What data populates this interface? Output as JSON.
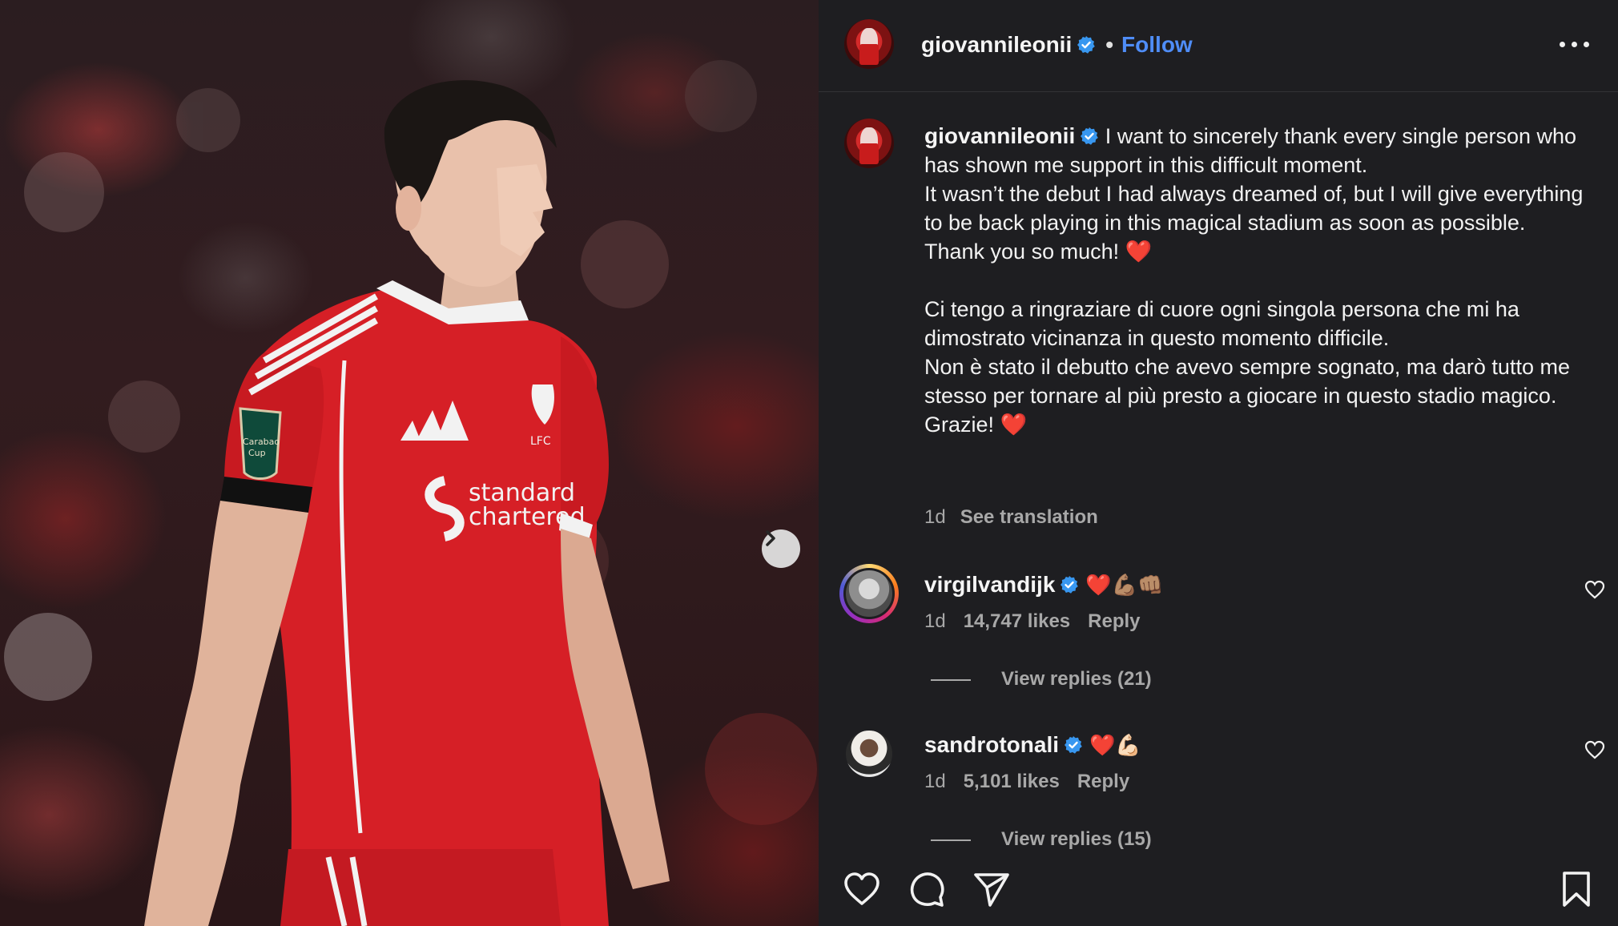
{
  "post": {
    "username": "giovannileonii",
    "follow_label": "Follow",
    "caption_username": "giovannileonii",
    "caption": " I want to sincerely thank every single person who has shown me support in this difficult moment.\nIt wasn’t the debut I had always dreamed of, but I will give everything to be back playing in this magical stadium as soon as possible.\nThank you so much! ❤️\n\nCi tengo a ringraziare di cuore ogni singola persona che mi ha dimostrato vicinanza in questo momento difficile.\nNon è stato il debutto che avevo sempre sognato, ma darò tutto me stesso per tornare al più presto a giocare in questo stadio magico.\nGrazie! ❤️",
    "time": "1d",
    "see_translation": "See translation"
  },
  "photo": {
    "shirt_sponsor_line1": "standard",
    "shirt_sponsor_line2": "chartered",
    "crest_text": "LFC",
    "badge_line1": "Carabao",
    "badge_line2": "Cup"
  },
  "comments": [
    {
      "username": "virgilvandijk",
      "text": "❤️💪🏽👊🏽",
      "time": "1d",
      "likes": "14,747 likes",
      "reply_label": "Reply",
      "view_replies": "View replies (21)"
    },
    {
      "username": "sandrotonali",
      "text": "❤️💪🏻",
      "time": "1d",
      "likes": "5,101 likes",
      "reply_label": "Reply",
      "view_replies": "View replies (15)"
    }
  ],
  "icons": {
    "header_more": "more-options-icon",
    "verified": "verified-badge-icon",
    "next": "chevron-right-icon",
    "like": "heart-icon",
    "comment": "comment-icon",
    "share": "send-icon",
    "save": "bookmark-icon"
  },
  "colors": {
    "background": "#1e1e21",
    "follow": "#4f8df7",
    "verified": "#3897f0",
    "muted": "#a8a8a8"
  }
}
